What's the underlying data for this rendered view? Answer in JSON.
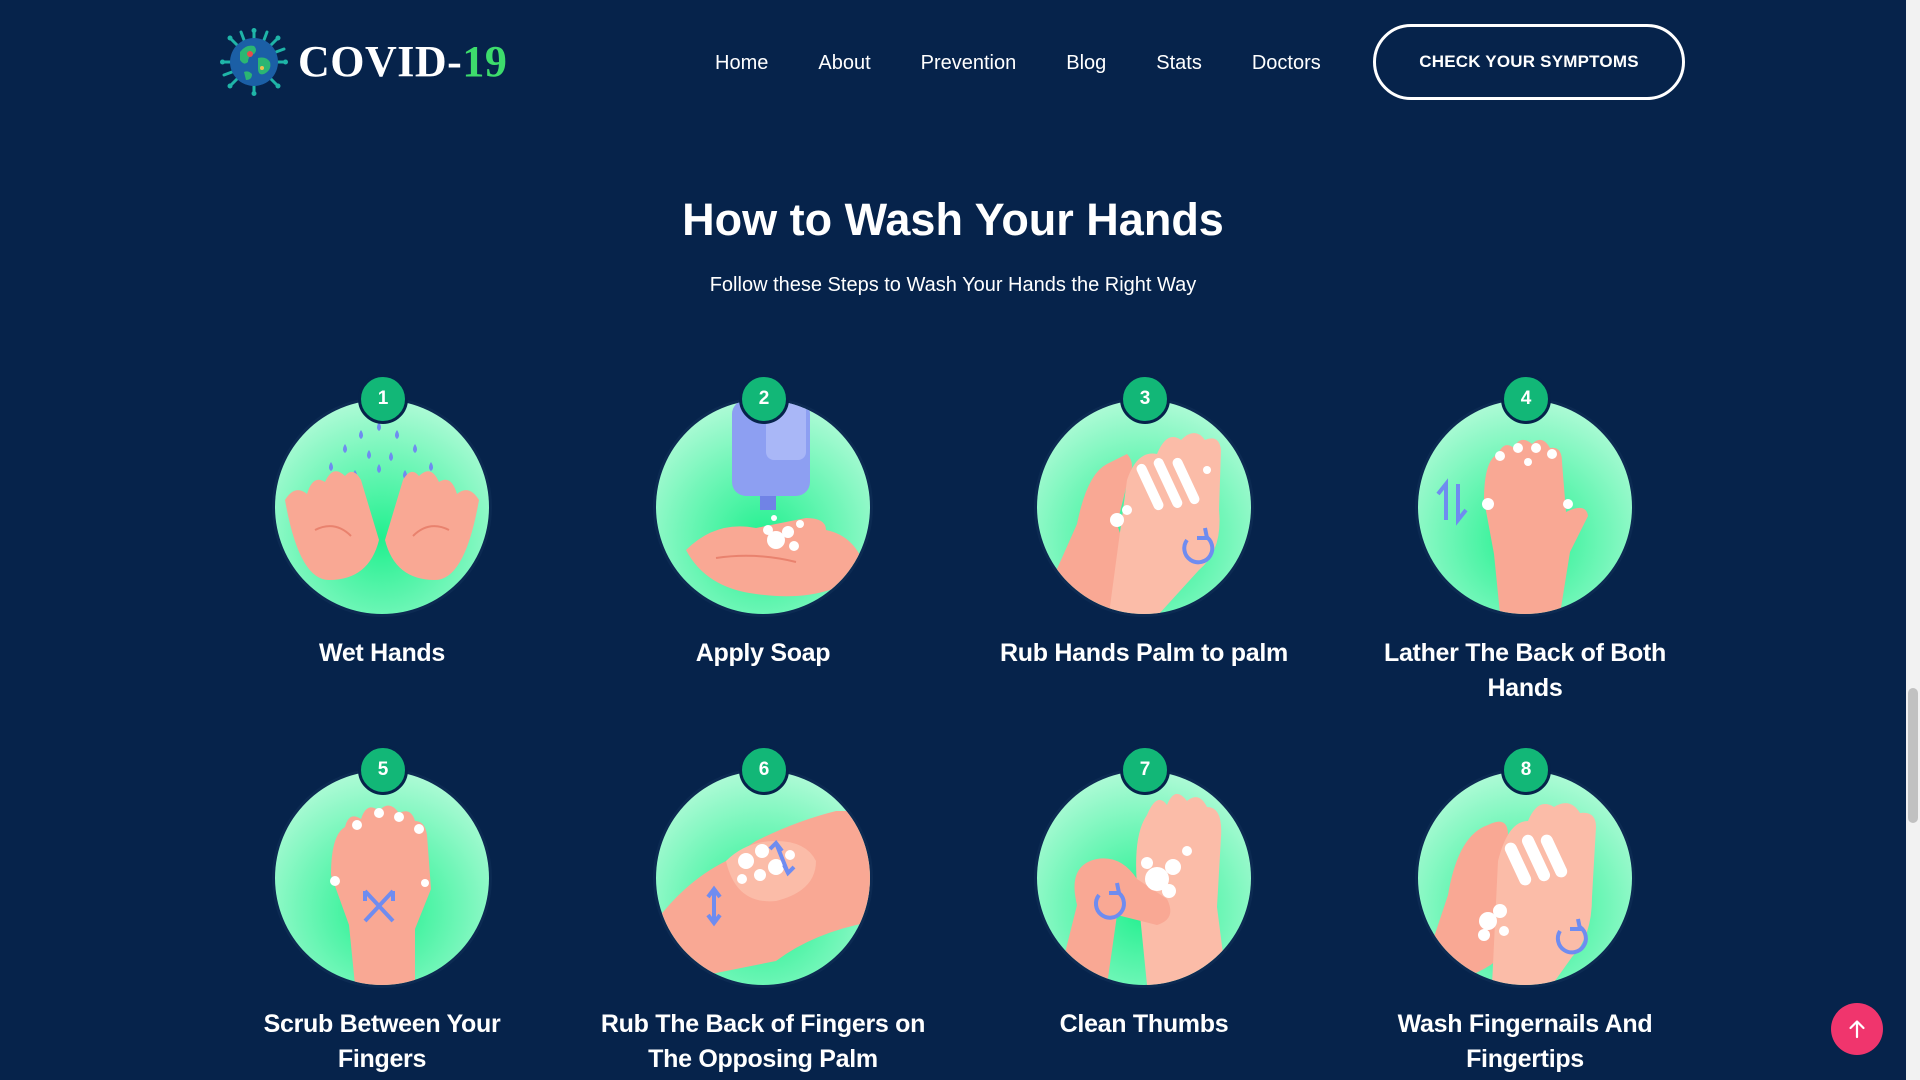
{
  "brand": {
    "name_main": "COVID-",
    "name_accent": "19",
    "logo_icon": "virus-globe-icon"
  },
  "nav": {
    "items": [
      {
        "label": "Home"
      },
      {
        "label": "About"
      },
      {
        "label": "Prevention"
      },
      {
        "label": "Blog"
      },
      {
        "label": "Stats"
      },
      {
        "label": "Doctors"
      }
    ],
    "cta_label": "CHECK YOUR SYMPTOMS"
  },
  "section": {
    "title": "How to Wash Your Hands",
    "subtitle": "Follow these Steps to Wash Your Hands the Right Way"
  },
  "steps": [
    {
      "number": "1",
      "label": "Wet Hands",
      "icon": "wet-hands-icon"
    },
    {
      "number": "2",
      "label": "Apply Soap",
      "icon": "apply-soap-icon"
    },
    {
      "number": "3",
      "label": "Rub Hands Palm to palm",
      "icon": "rub-palms-icon"
    },
    {
      "number": "4",
      "label": "Lather The Back of Both Hands",
      "icon": "lather-back-icon"
    },
    {
      "number": "5",
      "label": "Scrub Between Your Fingers",
      "icon": "scrub-fingers-icon"
    },
    {
      "number": "6",
      "label": "Rub The Back of Fingers on The Opposing Palm",
      "icon": "rub-back-fingers-icon"
    },
    {
      "number": "7",
      "label": "Clean Thumbs",
      "icon": "clean-thumbs-icon"
    },
    {
      "number": "8",
      "label": "Wash Fingernails And Fingertips",
      "icon": "fingertips-icon"
    }
  ],
  "colors": {
    "background": "#06234b",
    "accent_green": "#3ddc6c",
    "badge_green": "#12b777",
    "back_to_top": "#f0356d"
  },
  "back_to_top_icon": "arrow-up-icon"
}
